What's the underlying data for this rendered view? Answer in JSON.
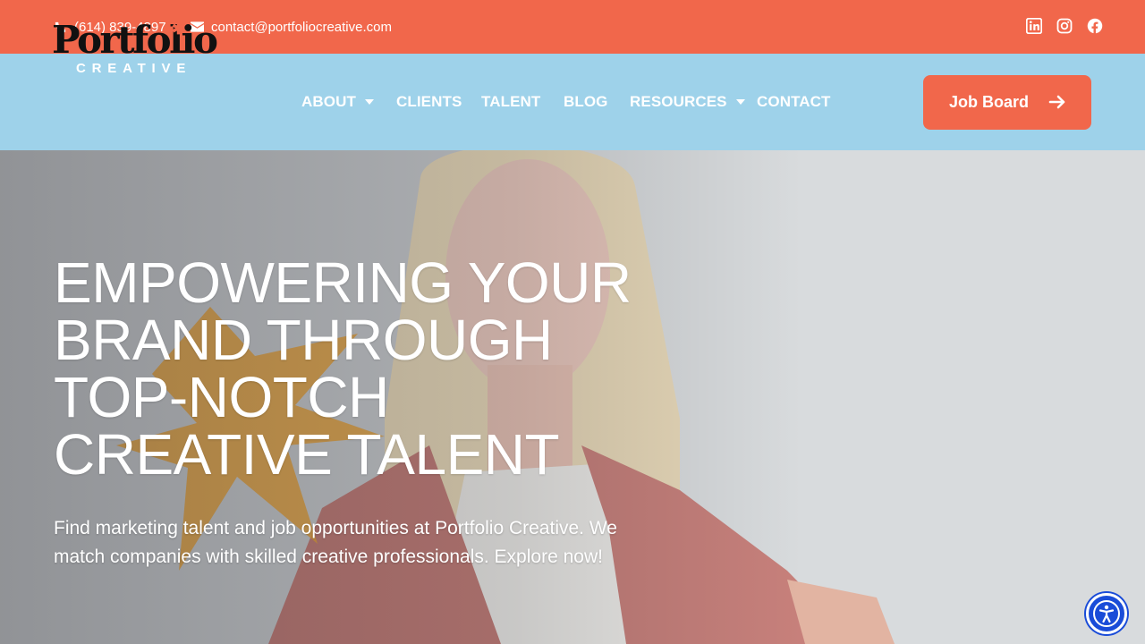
{
  "topbar": {
    "phone": "(614) 839-4897",
    "email": "contact@portfoliocreative.com",
    "social": [
      {
        "icon": "linkedin-icon"
      },
      {
        "icon": "instagram-icon"
      },
      {
        "icon": "facebook-icon"
      }
    ]
  },
  "logo": {
    "word": "Portfolio",
    "sub": "CREATIVE"
  },
  "nav": {
    "items": [
      {
        "label": "ABOUT",
        "has_dropdown": true
      },
      {
        "label": "CLIENTS",
        "has_dropdown": false
      },
      {
        "label": "TALENT",
        "has_dropdown": false
      },
      {
        "label": "BLOG",
        "has_dropdown": false
      },
      {
        "label": "RESOURCES",
        "has_dropdown": true
      },
      {
        "label": "CONTACT",
        "has_dropdown": false
      }
    ],
    "cta_label": "Job Board"
  },
  "hero": {
    "title_lines": [
      "EMPOWERING YOUR",
      "BRAND THROUGH",
      "TOP-NOTCH",
      "CREATIVE TALENT"
    ],
    "description": "Find marketing talent and job opportunities at Portfolio Creative. We match companies with skilled creative professionals. Explore now!"
  },
  "colors": {
    "accent": "#f1674b",
    "nav_bg": "#9ed2ea",
    "star": "#e8a23b",
    "a11y": "#1a4cd8"
  }
}
